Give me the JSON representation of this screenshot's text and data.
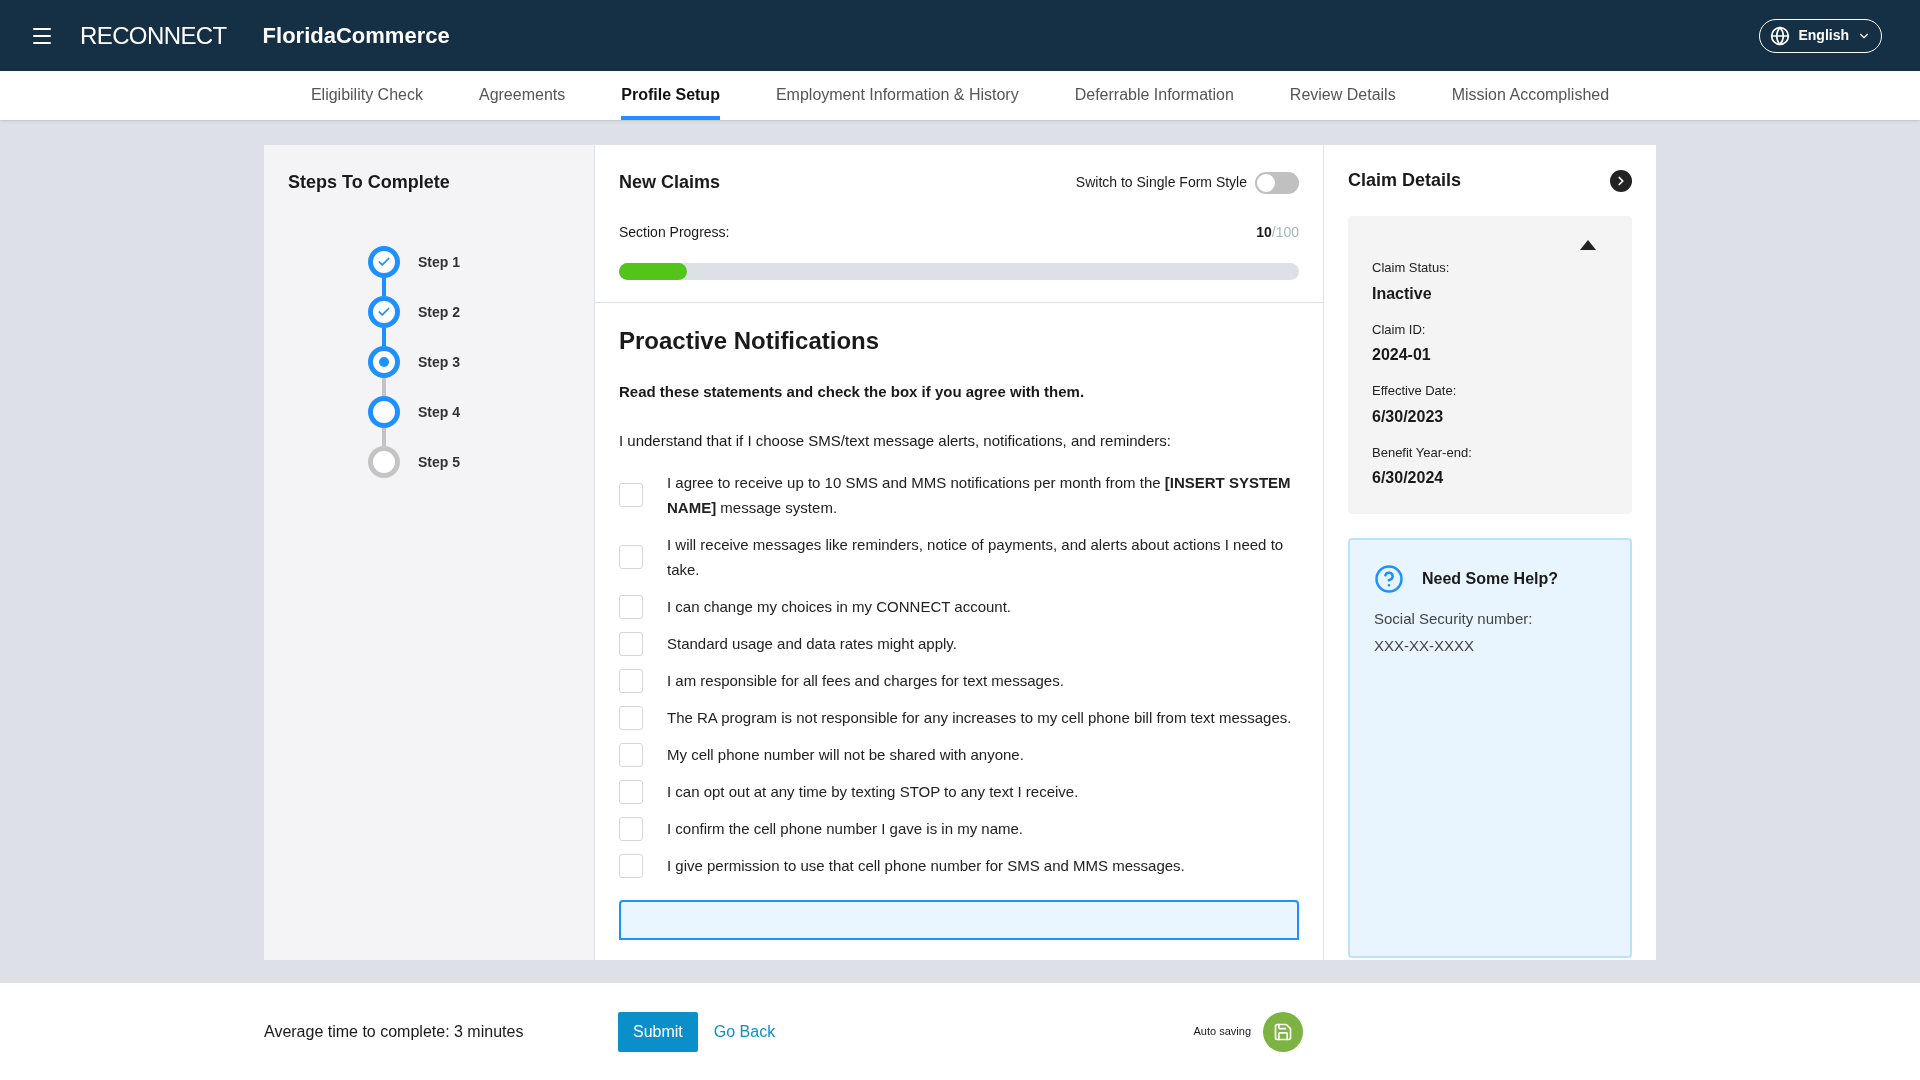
{
  "header": {
    "logo": "RECONNECT",
    "brand": "FloridaCommerce",
    "language": "English"
  },
  "tabs": [
    {
      "label": "Eligibility Check",
      "selected": false
    },
    {
      "label": "Agreements",
      "selected": false
    },
    {
      "label": "Profile Setup",
      "selected": true
    },
    {
      "label": "Employment Information & History",
      "selected": false
    },
    {
      "label": "Deferrable Information",
      "selected": false
    },
    {
      "label": "Review Details",
      "selected": false
    },
    {
      "label": "Mission Accomplished",
      "selected": false
    }
  ],
  "steps_panel": {
    "title": "Steps To Complete",
    "steps": [
      {
        "label": "Step 1",
        "kind": "complete"
      },
      {
        "label": "Step 2",
        "kind": "complete"
      },
      {
        "label": "Step 3",
        "kind": "current"
      },
      {
        "label": "Step 4",
        "kind": "next"
      },
      {
        "label": "Step 5",
        "kind": "pending"
      }
    ]
  },
  "form": {
    "title": "New Claims",
    "toggle": {
      "label": "Switch to Single Form Style",
      "on": false
    },
    "progress": {
      "label": "Section Progress:",
      "value": "10",
      "total": "/100",
      "level": 0.1
    },
    "section_title": "Proactive Notifications",
    "instruction": "Read these statements and check the box if you agree with them.",
    "intro": "I understand that if I choose SMS/text message alerts, notifications, and reminders:",
    "statements": [
      {
        "text": "I agree to receive up to 10 SMS and MMS notifications per month from the **[INSERT SYSTEM NAME]** message system.",
        "checked": false
      },
      {
        "text": "I will receive messages like reminders, notice of payments, and alerts about actions I need to take.",
        "checked": false
      },
      {
        "text": "I can change my choices in my CONNECT account.",
        "checked": false
      },
      {
        "text": "Standard usage and data rates might apply.",
        "checked": false
      },
      {
        "text": "I am responsible for all fees and charges for text messages.",
        "checked": false
      },
      {
        "text": "The RA program is not responsible for any increases to my cell phone bill from text messages.",
        "checked": false
      },
      {
        "text": "My cell phone number will not be shared with anyone.",
        "checked": false
      },
      {
        "text": "I can opt out at any time by texting STOP to any text I receive.",
        "checked": false
      },
      {
        "text": "I confirm the cell phone number I gave is in my name.",
        "checked": false
      },
      {
        "text": "I give permission to use that cell phone number for SMS and MMS messages.",
        "checked": false
      }
    ]
  },
  "claim_details": {
    "title": "Claim Details",
    "expanded": true,
    "fields": [
      {
        "label": "Claim Status:",
        "value": "Inactive"
      },
      {
        "label": "Claim ID:",
        "value": "2024-01"
      },
      {
        "label": "Effective Date:",
        "value": "6/30/2023"
      },
      {
        "label": "Benefit Year-end:",
        "value": "6/30/2024"
      }
    ]
  },
  "help": {
    "title": "Need Some Help?",
    "label": "Social Security number:",
    "value": "XXX-XX-XXXX"
  },
  "footer": {
    "time": "Average time to complete: 3 minutes",
    "submit": "Submit",
    "back": "Go Back",
    "autosave": "Auto saving"
  }
}
